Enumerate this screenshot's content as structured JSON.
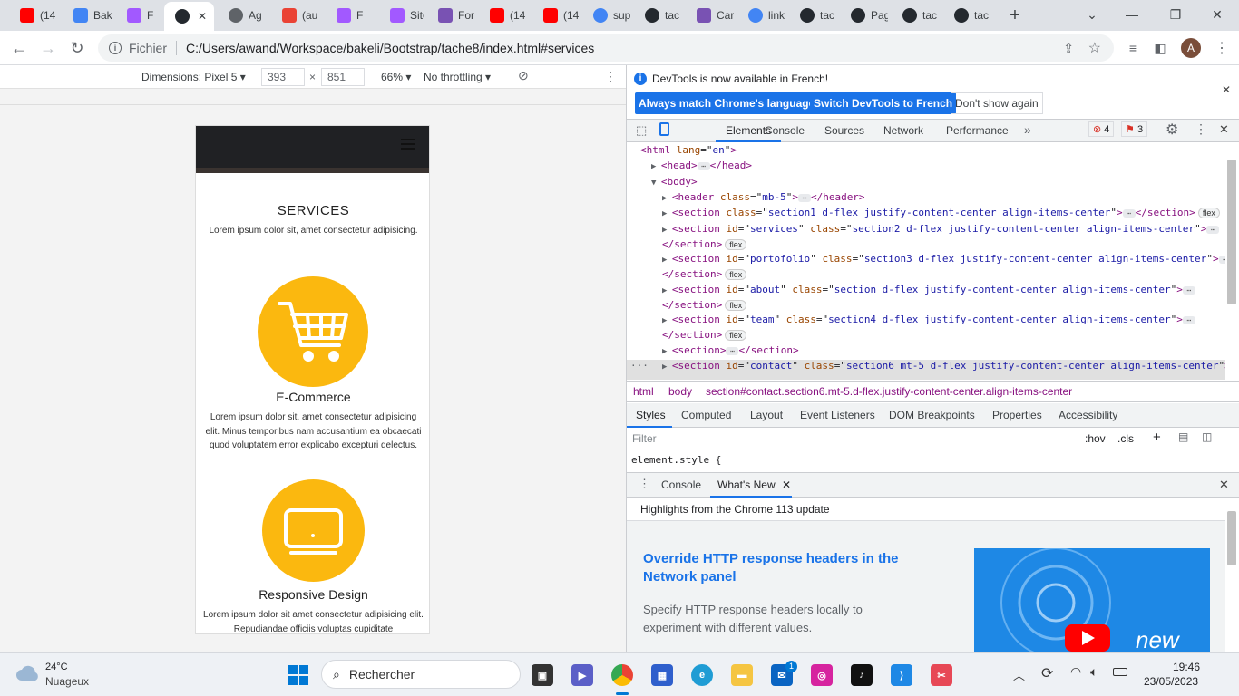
{
  "tabs": [
    {
      "label": "(14",
      "icon": "youtube-icon",
      "color": "#ff0000"
    },
    {
      "label": "Bak",
      "icon": "bakeli-icon",
      "color": "#4285f4"
    },
    {
      "label": "F",
      "icon": "figma-icon",
      "color": "#a259ff"
    },
    {
      "label": "",
      "icon": "github-icon",
      "color": "#24292f",
      "active": true
    },
    {
      "label": "Ag",
      "icon": "globe-icon",
      "color": "#5f6368"
    },
    {
      "label": "(au",
      "icon": "gmail-icon",
      "color": "#ea4335"
    },
    {
      "label": "F",
      "icon": "figma-icon",
      "color": "#a259ff"
    },
    {
      "label": "Site",
      "icon": "figma-icon",
      "color": "#a259ff"
    },
    {
      "label": "For",
      "icon": "bootstrap-icon",
      "color": "#7952b3"
    },
    {
      "label": "(14",
      "icon": "youtube-icon",
      "color": "#ff0000"
    },
    {
      "label": "(14",
      "icon": "youtube-icon",
      "color": "#ff0000"
    },
    {
      "label": "sup",
      "icon": "google-icon",
      "color": "#4285f4"
    },
    {
      "label": "tac",
      "icon": "github-icon",
      "color": "#24292f"
    },
    {
      "label": "Car",
      "icon": "bootstrap-icon",
      "color": "#7952b3"
    },
    {
      "label": "link",
      "icon": "google-icon",
      "color": "#4285f4"
    },
    {
      "label": "tac",
      "icon": "github-icon",
      "color": "#24292f"
    },
    {
      "label": "Pag",
      "icon": "github-icon",
      "color": "#24292f"
    },
    {
      "label": "tac",
      "icon": "github-icon",
      "color": "#24292f"
    },
    {
      "label": "tac",
      "icon": "github-icon",
      "color": "#24292f"
    }
  ],
  "omnibox": {
    "scheme_label": "Fichier",
    "url": "C:/Users/awand/Workspace/bakeli/Bootstrap/tache8/index.html#services",
    "profile_initial": "A"
  },
  "device_toolbar": {
    "dimensions_label": "Dimensions: Pixel 5",
    "width": "393",
    "times": "×",
    "height": "851",
    "zoom": "66%",
    "throttling": "No throttling"
  },
  "page": {
    "section_title": "SERVICES",
    "section_subtitle": "Lorem ipsum dolor sit, amet consectetur adipisicing.",
    "services": [
      {
        "title": "E-Commerce",
        "text": "Lorem ipsum dolor sit, amet consectetur adipisicing elit. Minus temporibus nam accusantium ea obcaecati quod voluptatem error explicabo excepturi delectus.",
        "icon": "shopping-cart-icon"
      },
      {
        "title": "Responsive Design",
        "text": "Lorem ipsum dolor sit amet consectetur adipisicing elit. Repudiandae officiis voluptas cupiditate",
        "icon": "laptop-icon"
      }
    ],
    "accent": "#fbb80f"
  },
  "devtools": {
    "info_text": "DevTools is now available in French!",
    "btn_match": "Always match Chrome's language",
    "btn_switch": "Switch DevTools to French",
    "btn_dismiss": "Don't show again",
    "tabs": [
      "Elements",
      "Console",
      "Sources",
      "Network",
      "Performance"
    ],
    "errors": "4",
    "warnings": "3",
    "breadcrumbs": [
      "html",
      "body",
      "section#contact.section6.mt-5.d-flex.justify-content-center.align-items-center"
    ],
    "style_tabs": [
      "Styles",
      "Computed",
      "Layout",
      "Event Listeners",
      "DOM Breakpoints",
      "Properties",
      "Accessibility"
    ],
    "filter_placeholder": "Filter",
    "hov": ":hov",
    "cls": ".cls",
    "element_style": "element.style {",
    "drawer_tabs": [
      "Console",
      "What's New"
    ],
    "highlights": "Highlights from the Chrome 113 update",
    "news_title": "Override HTTP response headers in the Network panel",
    "news_text": "Specify HTTP response headers locally to experiment with different values.",
    "news_badge": "new"
  },
  "dom": [
    {
      "open": "<html ",
      "attrs": [
        [
          "lang",
          "en"
        ]
      ],
      "close": ">"
    },
    {
      "open": "<head>",
      "ell": true,
      "end": "</head>"
    },
    {
      "open": "<body>"
    },
    {
      "open": "<header ",
      "attrs": [
        [
          "class",
          "mb-5"
        ]
      ],
      "close": ">",
      "ell": true,
      "end": "</header>"
    },
    {
      "open": "<section ",
      "attrs": [
        [
          "class",
          "section1 d-flex justify-content-center align-items-center"
        ]
      ],
      "close": ">",
      "ell": true,
      "end": "</section>",
      "badge": "flex"
    },
    {
      "open": "<section ",
      "attrs": [
        [
          "id",
          "services"
        ],
        [
          "class",
          "section2 d-flex justify-content-center align-items-center"
        ]
      ],
      "close": ">",
      "ell": true,
      "end2": "</section>",
      "badge": "flex"
    },
    {
      "open": "<section ",
      "attrs": [
        [
          "id",
          "portofolio"
        ],
        [
          "class",
          "section3 d-flex justify-content-center align-items-center"
        ]
      ],
      "close": ">",
      "ell": true,
      "end2": "</section>",
      "badge": "flex"
    },
    {
      "open": "<section ",
      "attrs": [
        [
          "id",
          "about"
        ],
        [
          "class",
          "section d-flex justify-content-center align-items-center"
        ]
      ],
      "close": ">",
      "ell": true,
      "end2": "</section>",
      "badge": "flex"
    },
    {
      "open": "<section ",
      "attrs": [
        [
          "id",
          "team"
        ],
        [
          "class",
          "section4 d-flex justify-content-center align-items-center"
        ]
      ],
      "close": ">",
      "ell": true,
      "end2": "</section>",
      "badge": "flex"
    },
    {
      "open": "<section>",
      "ell": true,
      "end": "</section>"
    },
    {
      "open": "<section ",
      "attrs": [
        [
          "id",
          "contact"
        ],
        [
          "class",
          "section6 mt-5 d-flex justify-content-center align-items-center"
        ]
      ],
      "close": ">",
      "ell": true,
      "selected": true
    }
  ],
  "taskbar": {
    "temp": "24°C",
    "weather": "Nuageux",
    "search": "Rechercher",
    "time": "19:46",
    "date": "23/05/2023",
    "mail_badge": "1"
  }
}
